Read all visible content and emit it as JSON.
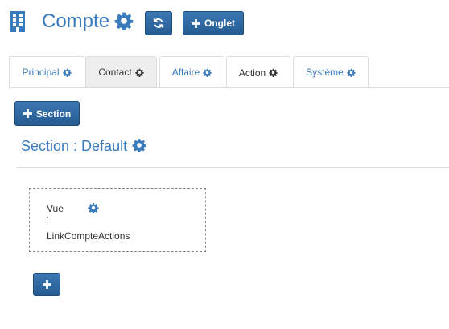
{
  "header": {
    "title": "Compte",
    "onglet_label": "Onglet",
    "icons": [
      "building-icon",
      "gear-icon",
      "refresh-icon",
      "plus-icon"
    ]
  },
  "tabs": [
    {
      "label": "Principal"
    },
    {
      "label": "Contact"
    },
    {
      "label": "Affaire"
    },
    {
      "label": "Action"
    },
    {
      "label": "Système"
    }
  ],
  "section": {
    "add_label": "Section",
    "title": "Section : Default"
  },
  "view": {
    "label": "Vue",
    "separator": ":",
    "value": "LinkCompteActions"
  },
  "colors": {
    "accent": "#3a7bbd",
    "button": "#2b6198"
  }
}
